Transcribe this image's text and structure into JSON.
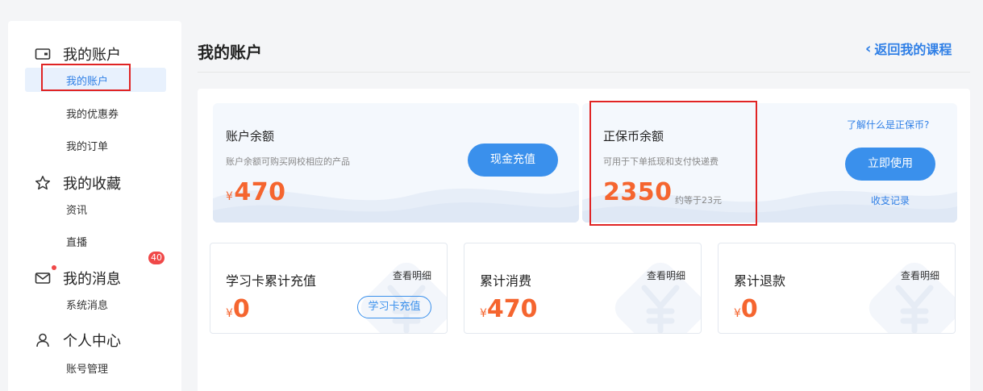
{
  "sidebar": {
    "groups": [
      {
        "label": "我的账户",
        "icon": "wallet-icon",
        "items": [
          "我的账户",
          "我的优惠券",
          "我的订单"
        ]
      },
      {
        "label": "我的收藏",
        "icon": "star-icon",
        "items": [
          "资讯",
          "直播"
        ]
      },
      {
        "label": "我的消息",
        "icon": "mail-icon",
        "badge": "40",
        "items": [
          "系统消息"
        ]
      },
      {
        "label": "个人中心",
        "icon": "user-icon",
        "items": [
          "账号管理"
        ]
      }
    ],
    "active_item": "我的账户"
  },
  "page": {
    "title": "我的账户",
    "back_link": "返回我的课程"
  },
  "balance_card": {
    "title": "账户余额",
    "desc": "账户余额可购买网校相应的产品",
    "currency": "¥",
    "amount": "470",
    "button": "现金充值"
  },
  "coin_card": {
    "title": "正保币余额",
    "desc": "可用于下单抵现和支付快递费",
    "amount": "2350",
    "approx": "约等于23元",
    "help_link": "了解什么是正保币?",
    "button": "立即使用",
    "records_link": "收支记录"
  },
  "stats": [
    {
      "title": "学习卡累计充值",
      "link": "查看明细",
      "currency": "¥",
      "value": "0",
      "button": "学习卡充值"
    },
    {
      "title": "累计消费",
      "link": "查看明细",
      "currency": "¥",
      "value": "470"
    },
    {
      "title": "累计退款",
      "link": "查看明细",
      "currency": "¥",
      "value": "0"
    }
  ],
  "colors": {
    "accent": "#3a90ec",
    "amount": "#f5652f",
    "highlight": "#e02424"
  }
}
